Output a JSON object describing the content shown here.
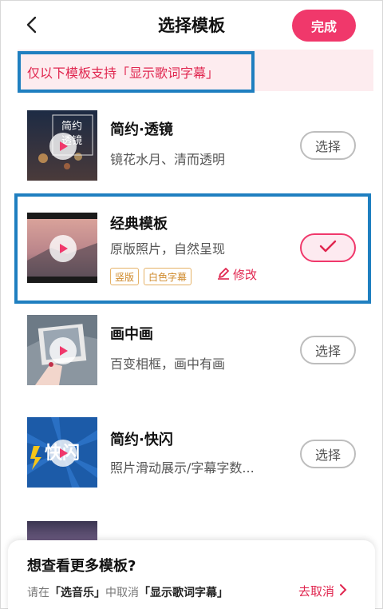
{
  "header": {
    "title": "选择模板",
    "done_label": "完成"
  },
  "notice": {
    "text": "仅以下模板支持「显示歌词字幕」"
  },
  "templates": [
    {
      "name": "简约·透镜",
      "desc": "镜花水月、清而透明",
      "action": "选择",
      "thumb_text": "简约\n透镜"
    },
    {
      "name": "经典模板",
      "desc": "原版照片，自然呈现",
      "selected": true,
      "tags": [
        "竖版",
        "白色字幕"
      ],
      "edit_label": "修改"
    },
    {
      "name": "画中画",
      "desc": "百变相框，画中有画",
      "action": "选择"
    },
    {
      "name": "简约·快闪",
      "desc": "照片滑动展示/字幕字数...",
      "action": "选择",
      "thumb_text": "快闪"
    }
  ],
  "sheet": {
    "title": "想查看更多模板?",
    "line_prefix": "请在",
    "line_music": "「选音乐」",
    "line_mid": "中取消",
    "line_feature": "「显示歌词字幕」",
    "cancel_label": "去取消"
  },
  "colors": {
    "accent": "#f0386b",
    "highlight_border": "#1f7fc0",
    "notice_bg": "#fdecef",
    "tag": "#cf8a2b"
  }
}
